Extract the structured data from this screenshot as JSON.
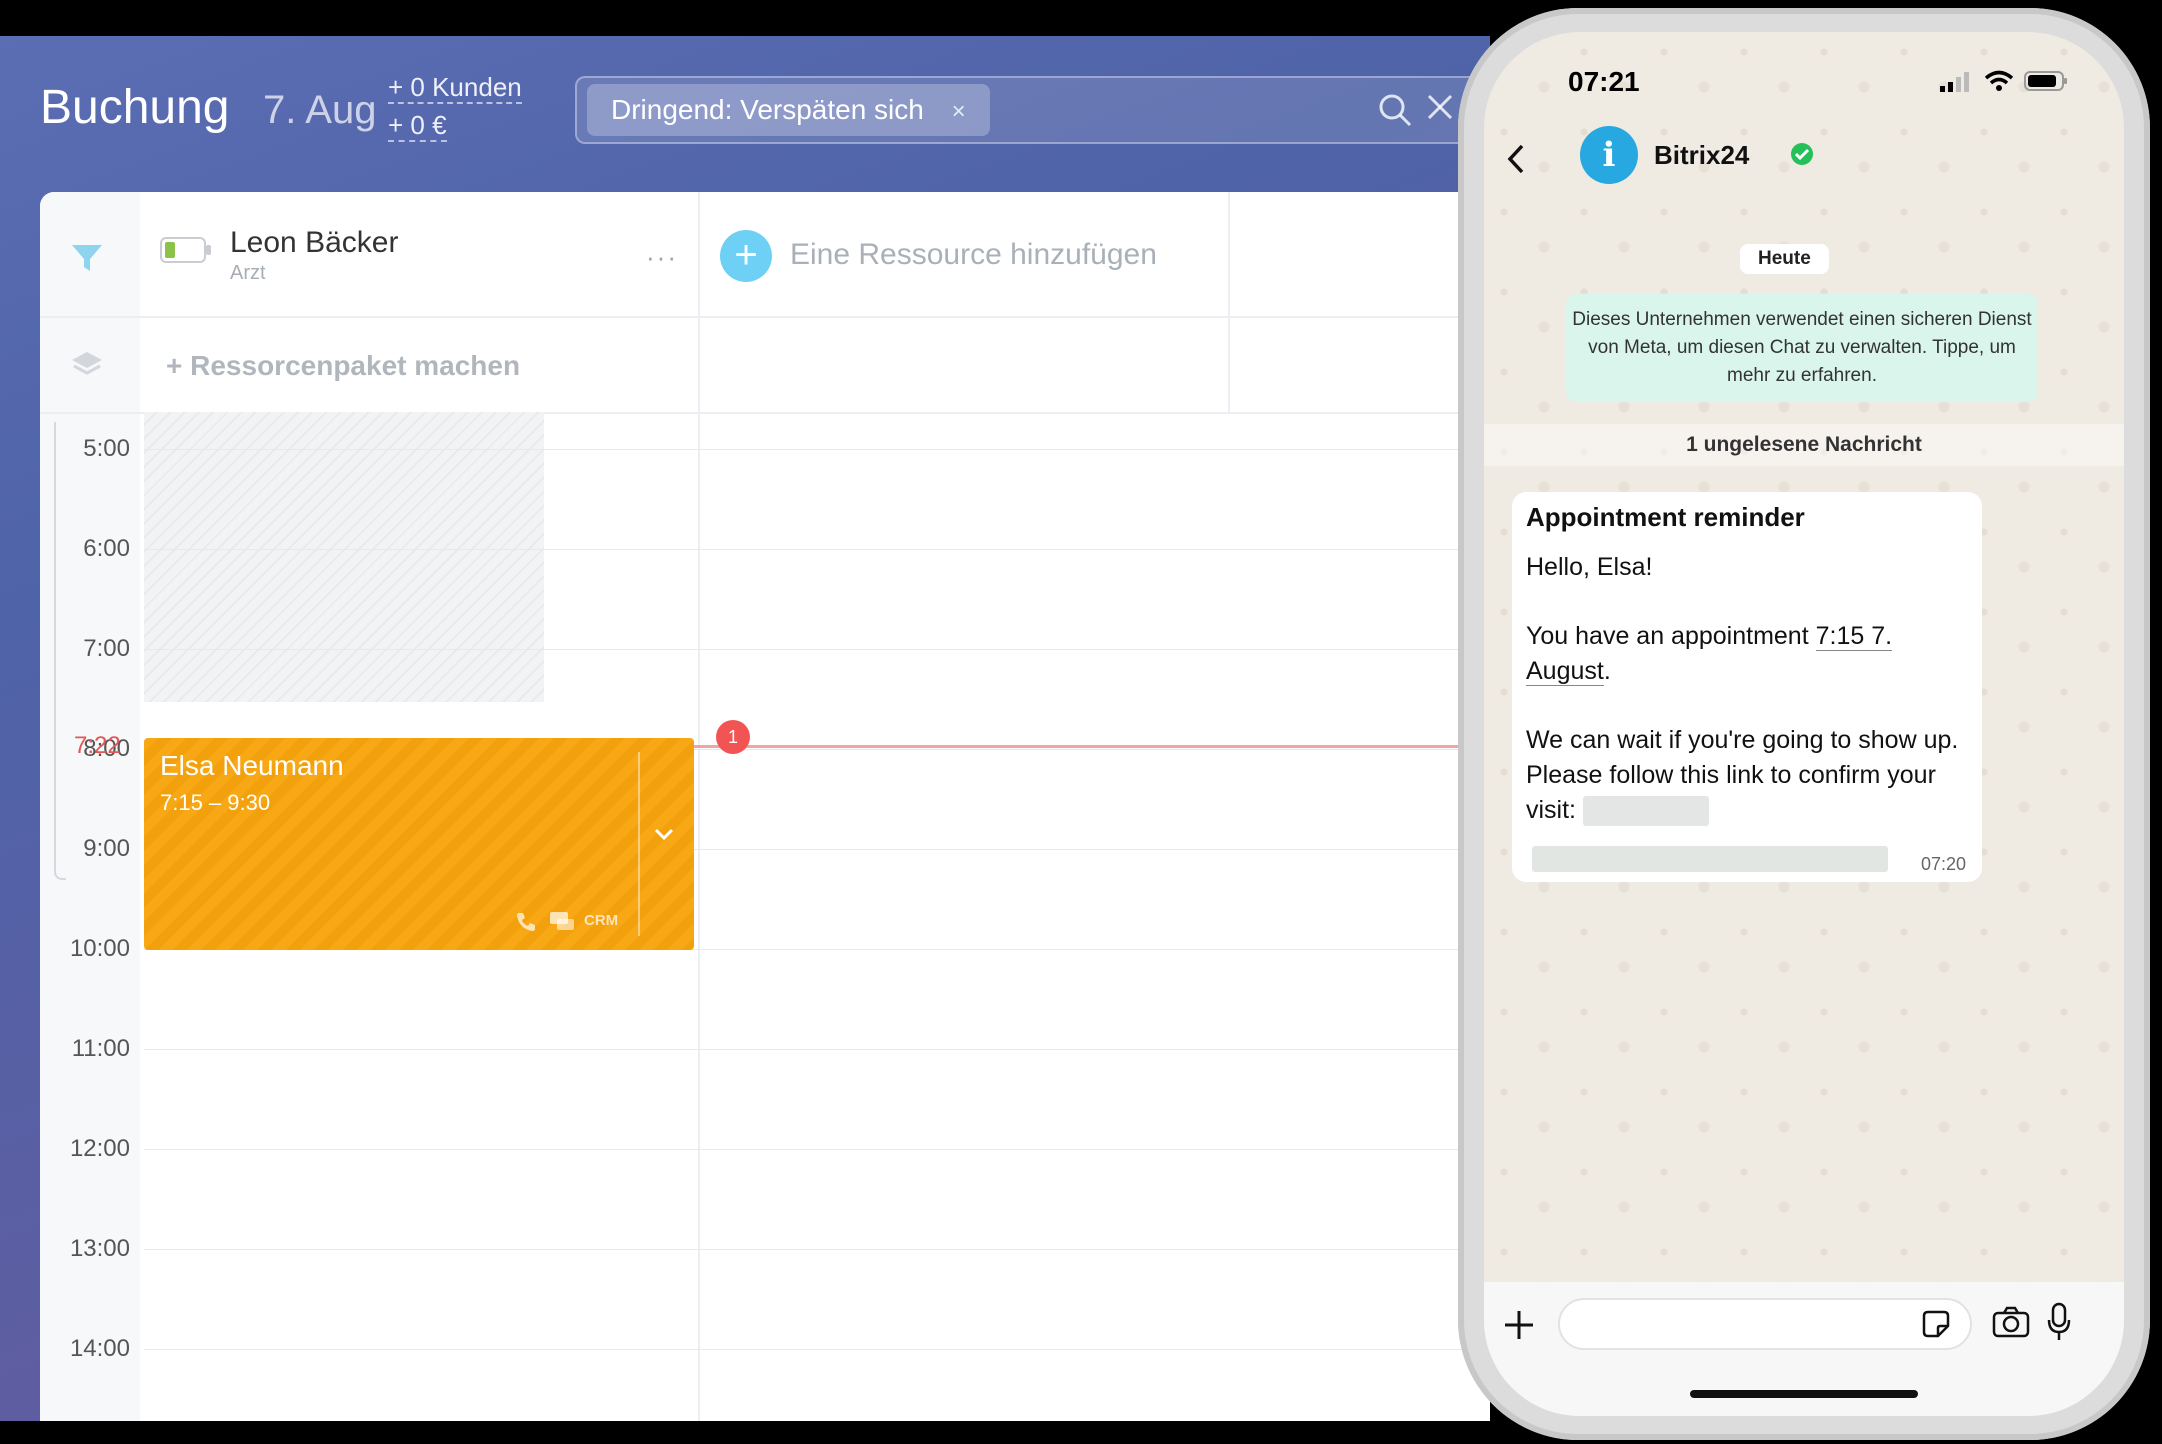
{
  "booking": {
    "title": "Buchung",
    "date": "7. Aug",
    "clients_stat": "+ 0 Kunden",
    "revenue_stat": "+ 0 €",
    "filter_chip": "Dringend: Verspäten sich",
    "filter_chip_close": "×",
    "resource": {
      "name": "Leon Bäcker",
      "role": "Arzt",
      "more": "···"
    },
    "add_resource_label": "Eine Ressource hinzufügen",
    "bundle_label": "+ Ressorcenpaket machen",
    "times": [
      "5:00",
      "6:00",
      "7:00",
      "8:00",
      "9:00",
      "10:00",
      "11:00",
      "12:00",
      "13:00",
      "14:00"
    ],
    "now_label": "7:22",
    "event": {
      "name": "Elsa Neumann",
      "time": "7:15 – 9:30",
      "crm": "CRM"
    },
    "notification_count": "1",
    "colors": {
      "event": "#f8a814",
      "accent": "#6dd0f4",
      "now": "#e05858"
    }
  },
  "phone": {
    "status_time": "07:21",
    "contact_name": "Bitrix24",
    "avatar_letter": "i",
    "date_pill": "Heute",
    "meta_notice": "Dieses Unternehmen verwendet einen sicheren Dienst von Meta, um diesen Chat zu verwalten. Tippe, um mehr zu erfahren.",
    "unread": "1 ungelesene Nachricht",
    "message": {
      "title": "Appointment reminder",
      "greeting": "Hello, Elsa!",
      "line_a": "You have an appointment ",
      "line_link": "7:15 7. August",
      "line_end": ".",
      "line_b": "We can wait if you're going to show up. Please follow this link to confirm your visit:",
      "timestamp": "07:20"
    }
  }
}
